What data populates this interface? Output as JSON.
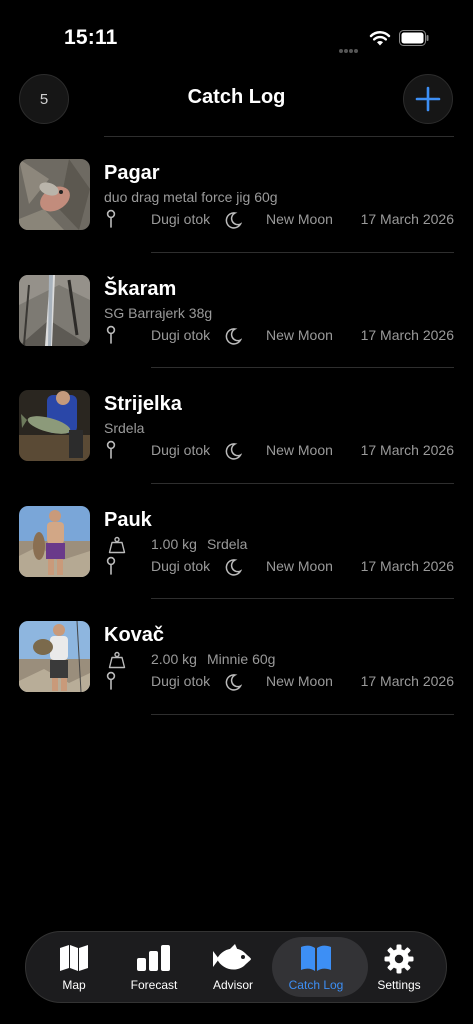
{
  "status_bar": {
    "time": "15:11"
  },
  "header": {
    "count": "5",
    "title": "Catch Log",
    "add_icon": "plus-icon"
  },
  "catches": [
    {
      "name": "Pagar",
      "subtitle": "duo drag metal force jig 60g",
      "location": "Dugi otok",
      "moon_phase": "New Moon",
      "date": "17 March 2026"
    },
    {
      "name": "Škaram",
      "subtitle": "SG Barrajerk 38g",
      "location": "Dugi otok",
      "moon_phase": "New Moon",
      "date": "17 March 2026"
    },
    {
      "name": "Strijelka",
      "subtitle": "Srdela",
      "location": "Dugi otok",
      "moon_phase": "New Moon",
      "date": "17 March 2026"
    },
    {
      "name": "Pauk",
      "weight": "1.00 kg",
      "lure": "Srdela",
      "location": "Dugi otok",
      "moon_phase": "New Moon",
      "date": "17 March 2026"
    },
    {
      "name": "Kovač",
      "weight": "2.00 kg",
      "lure": "Minnie 60g",
      "location": "Dugi otok",
      "moon_phase": "New Moon",
      "date": "17 March 2026"
    }
  ],
  "tabs": [
    {
      "label": "Map",
      "icon": "map-icon",
      "active": false
    },
    {
      "label": "Forecast",
      "icon": "bar-chart-icon",
      "active": false
    },
    {
      "label": "Advisor",
      "icon": "fish-icon",
      "active": false
    },
    {
      "label": "Catch Log",
      "icon": "book-icon",
      "active": true
    },
    {
      "label": "Settings",
      "icon": "gear-icon",
      "active": false
    }
  ],
  "colors": {
    "accent": "#3d8ff5",
    "background": "#000000",
    "secondary_text": "#9a9a9a"
  }
}
